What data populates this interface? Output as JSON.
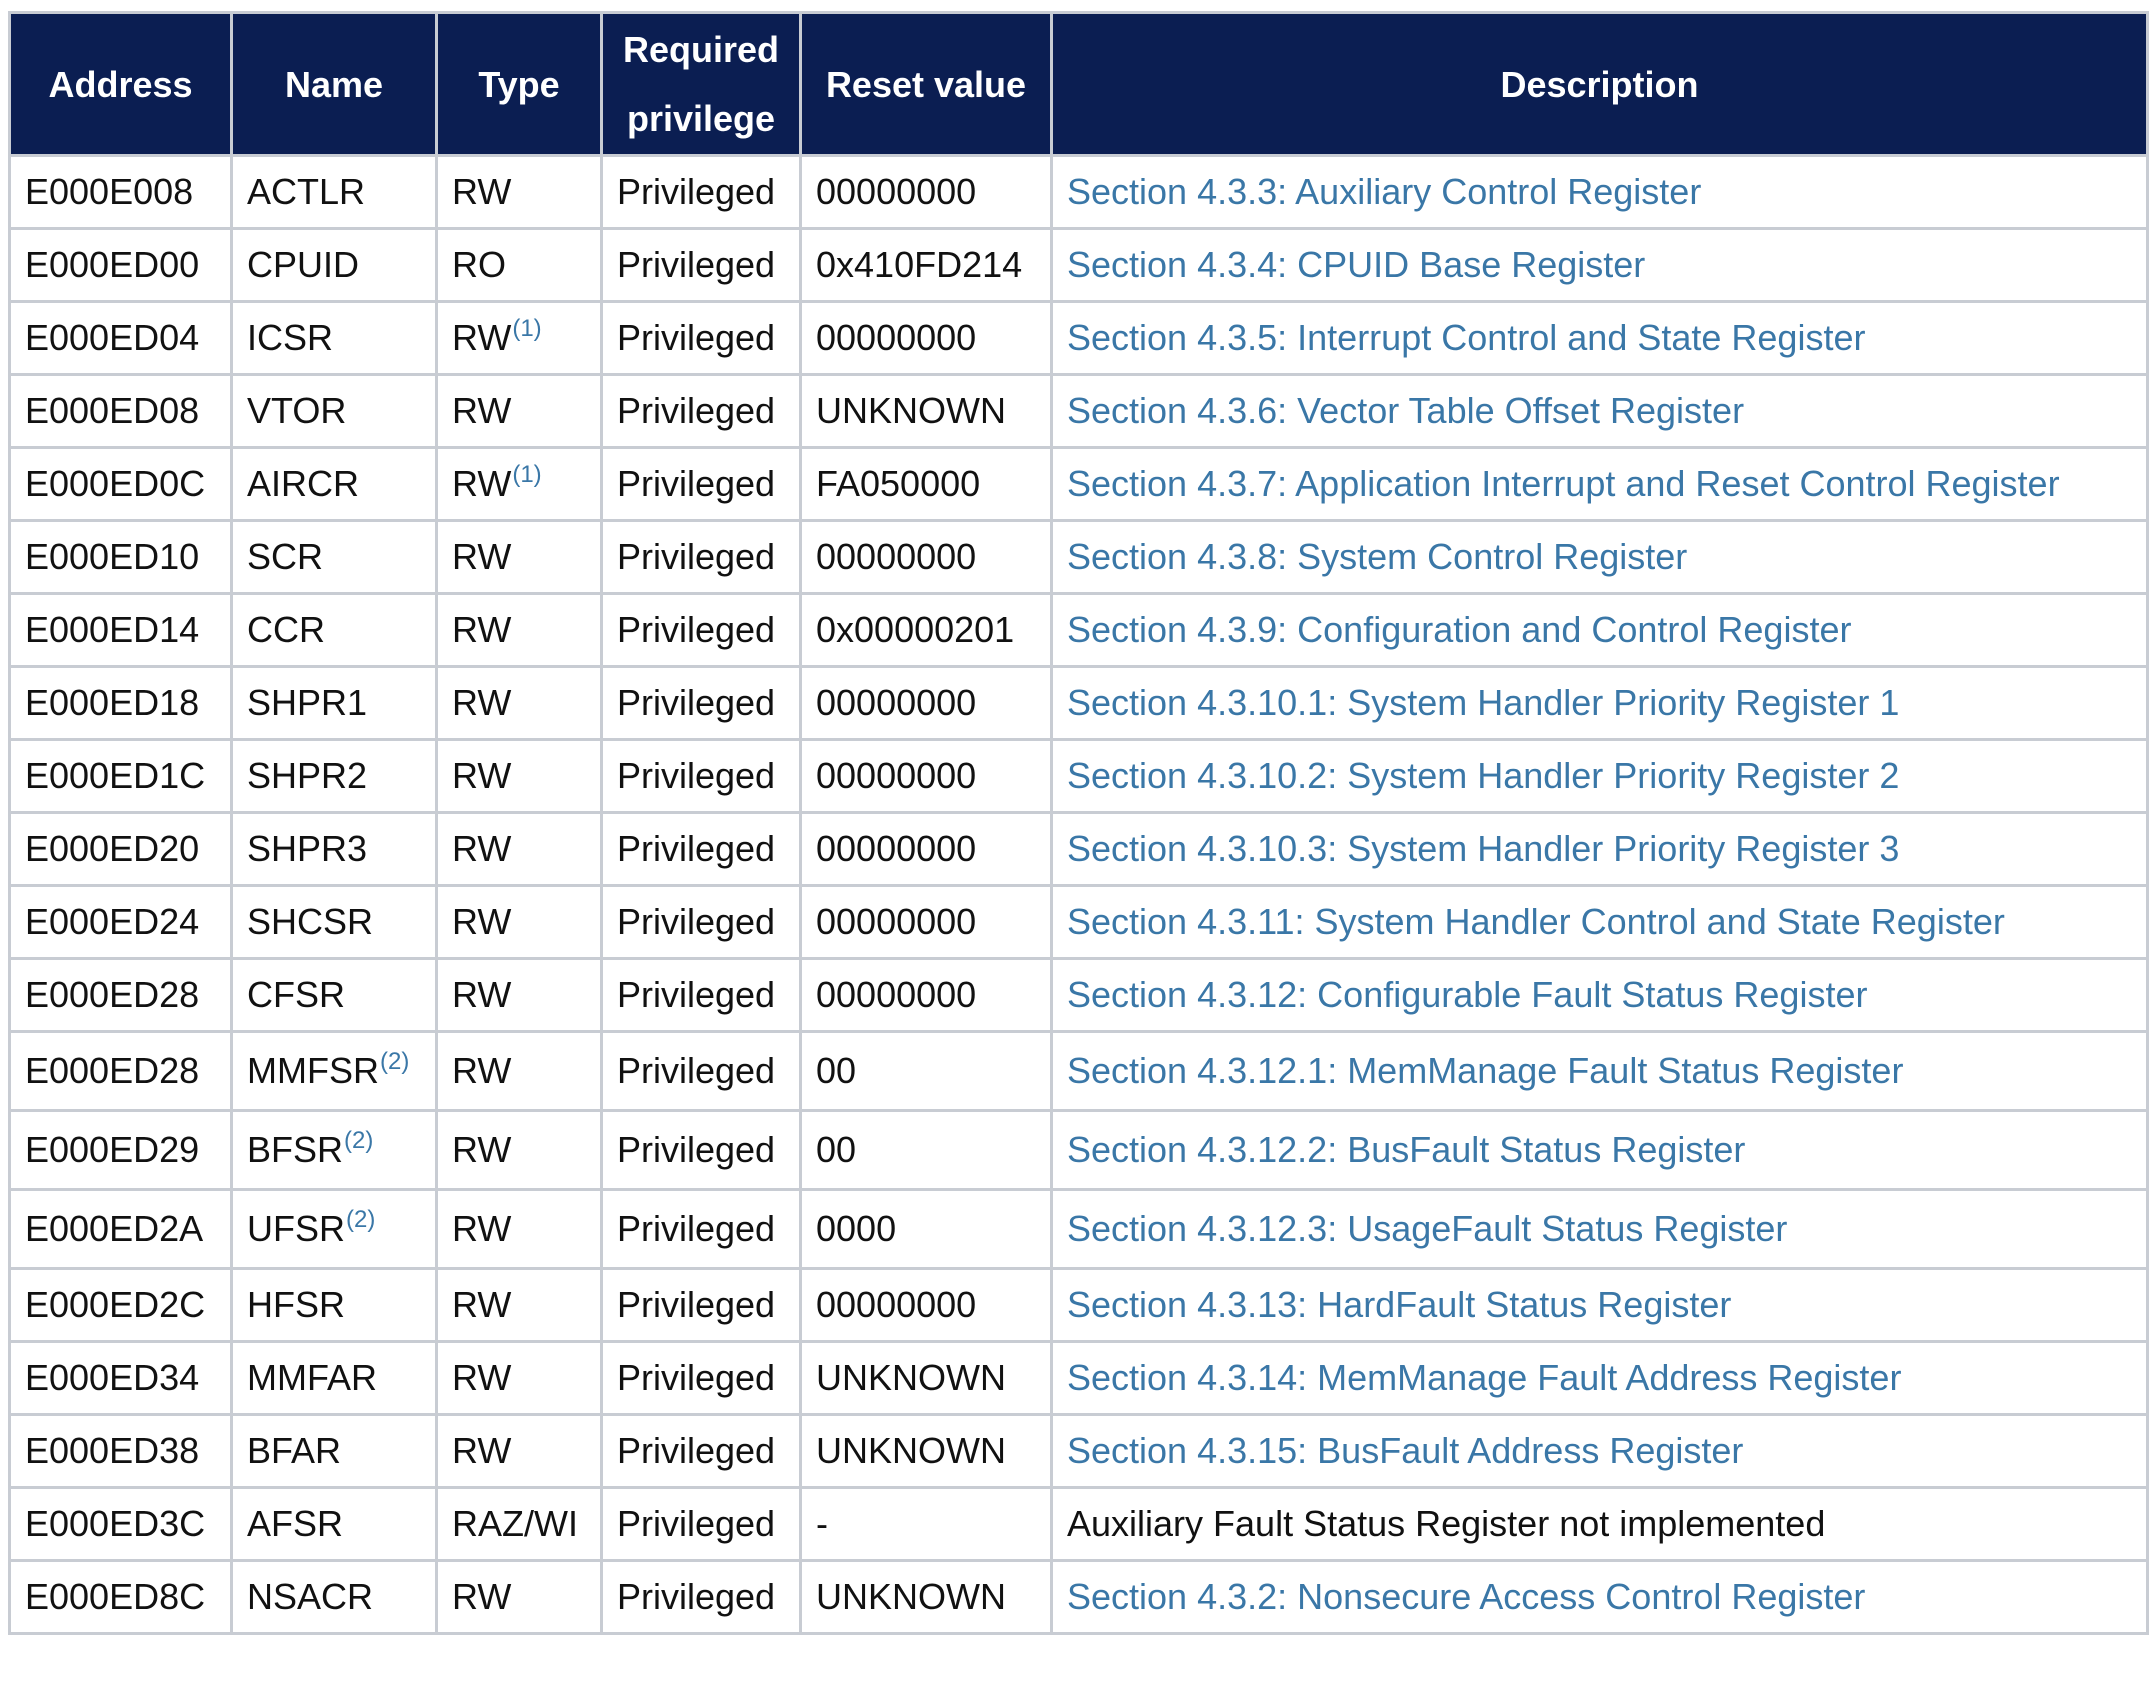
{
  "headers": [
    "Address",
    "Name",
    "Type",
    "Required privilege",
    "Reset value",
    "Description"
  ],
  "rows": [
    {
      "address": "E000E008",
      "name": "ACTLR",
      "name_fn": "",
      "type": "RW",
      "type_fn": "",
      "privilege": "Privileged",
      "reset": "00000000",
      "description": "Section 4.3.3: Auxiliary Control Register",
      "is_link": true
    },
    {
      "address": "E000ED00",
      "name": "CPUID",
      "name_fn": "",
      "type": "RO",
      "type_fn": "",
      "privilege": "Privileged",
      "reset": "0x410FD214",
      "description": "Section 4.3.4: CPUID Base Register",
      "is_link": true
    },
    {
      "address": "E000ED04",
      "name": "ICSR",
      "name_fn": "",
      "type": "RW",
      "type_fn": "(1)",
      "privilege": "Privileged",
      "reset": "00000000",
      "description": "Section 4.3.5: Interrupt Control and State Register",
      "is_link": true
    },
    {
      "address": "E000ED08",
      "name": "VTOR",
      "name_fn": "",
      "type": "RW",
      "type_fn": "",
      "privilege": "Privileged",
      "reset": "UNKNOWN",
      "description": "Section 4.3.6: Vector Table Offset Register",
      "is_link": true
    },
    {
      "address": "E000ED0C",
      "name": "AIRCR",
      "name_fn": "",
      "type": "RW",
      "type_fn": "(1)",
      "privilege": "Privileged",
      "reset": "FA050000",
      "description": "Section 4.3.7: Application Interrupt and Reset Control Register",
      "is_link": true
    },
    {
      "address": "E000ED10",
      "name": "SCR",
      "name_fn": "",
      "type": "RW",
      "type_fn": "",
      "privilege": "Privileged",
      "reset": "00000000",
      "description": "Section 4.3.8: System Control Register",
      "is_link": true
    },
    {
      "address": "E000ED14",
      "name": "CCR",
      "name_fn": "",
      "type": "RW",
      "type_fn": "",
      "privilege": "Privileged",
      "reset": "0x00000201",
      "description": "Section 4.3.9: Configuration and Control Register",
      "is_link": true
    },
    {
      "address": "E000ED18",
      "name": "SHPR1",
      "name_fn": "",
      "type": "RW",
      "type_fn": "",
      "privilege": "Privileged",
      "reset": "00000000",
      "description": "Section 4.3.10.1: System Handler Priority Register 1",
      "is_link": true
    },
    {
      "address": "E000ED1C",
      "name": "SHPR2",
      "name_fn": "",
      "type": "RW",
      "type_fn": "",
      "privilege": "Privileged",
      "reset": "00000000",
      "description": "Section 4.3.10.2: System Handler Priority Register 2",
      "is_link": true
    },
    {
      "address": "E000ED20",
      "name": "SHPR3",
      "name_fn": "",
      "type": "RW",
      "type_fn": "",
      "privilege": "Privileged",
      "reset": "00000000",
      "description": "Section 4.3.10.3: System Handler Priority Register 3",
      "is_link": true
    },
    {
      "address": "E000ED24",
      "name": "SHCSR",
      "name_fn": "",
      "type": "RW",
      "type_fn": "",
      "privilege": "Privileged",
      "reset": "00000000",
      "description": "Section 4.3.11: System Handler Control and State Register",
      "is_link": true
    },
    {
      "address": "E000ED28",
      "name": "CFSR",
      "name_fn": "",
      "type": "RW",
      "type_fn": "",
      "privilege": "Privileged",
      "reset": "00000000",
      "description": "Section 4.3.12: Configurable Fault Status Register",
      "is_link": true
    },
    {
      "address": "E000ED28",
      "name": "MMFSR",
      "name_fn": "(2)",
      "type": "RW",
      "type_fn": "",
      "privilege": "Privileged",
      "reset": "00",
      "description": "Section 4.3.12.1: MemManage Fault Status Register",
      "is_link": true
    },
    {
      "address": "E000ED29",
      "name": "BFSR",
      "name_fn": "(2)",
      "type": "RW",
      "type_fn": "",
      "privilege": "Privileged",
      "reset": "00",
      "description": "Section 4.3.12.2: BusFault Status Register",
      "is_link": true
    },
    {
      "address": "E000ED2A",
      "name": "UFSR",
      "name_fn": "(2)",
      "type": "RW",
      "type_fn": "",
      "privilege": "Privileged",
      "reset": "0000",
      "description": "Section 4.3.12.3: UsageFault Status Register",
      "is_link": true
    },
    {
      "address": "E000ED2C",
      "name": "HFSR",
      "name_fn": "",
      "type": "RW",
      "type_fn": "",
      "privilege": "Privileged",
      "reset": "00000000",
      "description": "Section 4.3.13: HardFault Status Register",
      "is_link": true
    },
    {
      "address": "E000ED34",
      "name": "MMFAR",
      "name_fn": "",
      "type": "RW",
      "type_fn": "",
      "privilege": "Privileged",
      "reset": "UNKNOWN",
      "description": "Section 4.3.14: MemManage Fault Address Register",
      "is_link": true
    },
    {
      "address": "E000ED38",
      "name": "BFAR",
      "name_fn": "",
      "type": "RW",
      "type_fn": "",
      "privilege": "Privileged",
      "reset": "UNKNOWN",
      "description": "Section 4.3.15: BusFault Address Register",
      "is_link": true
    },
    {
      "address": "E000ED3C",
      "name": "AFSR",
      "name_fn": "",
      "type": "RAZ/WI",
      "type_fn": "",
      "privilege": "Privileged",
      "reset": "-",
      "description": "Auxiliary Fault Status Register not implemented",
      "is_link": false
    },
    {
      "address": "E000ED8C",
      "name": "NSACR",
      "name_fn": "",
      "type": "RW",
      "type_fn": "",
      "privilege": "Privileged",
      "reset": "UNKNOWN",
      "description": "Section 4.3.2: Nonsecure Access Control Register",
      "is_link": true
    }
  ],
  "colors": {
    "header_bg": "#0b1e52",
    "header_text": "#ffffff",
    "link": "#3a77a7",
    "border": "#c8ccd3",
    "body_text": "#111111"
  }
}
